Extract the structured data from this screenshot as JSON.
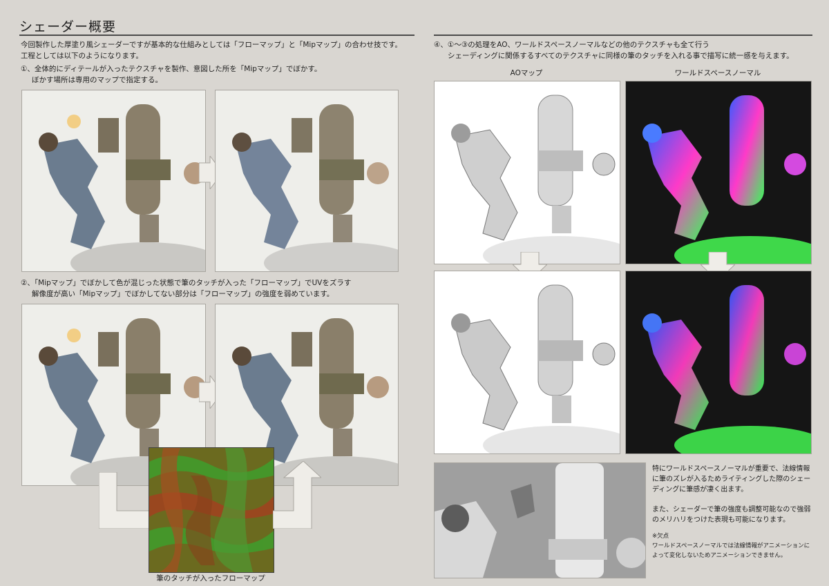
{
  "title": "シェーダー概要",
  "intro": {
    "line1": "今回製作した厚塗り風シェーダーですが基本的な仕組みとしては「フローマップ」と「Mipマップ」の合わせ技です。",
    "line2": "工程としては以下のようになります。"
  },
  "step1": {
    "line1": "①、全体的にディテールが入ったテクスチャを製作、意図した所を「Mipマップ」でぼかす。",
    "line2": "ぼかす場所は専用のマップで指定する。"
  },
  "step2": {
    "line1": "②、「Mipマップ」でぼかして色が混じった状態で筆のタッチが入った「フローマップ」でUVをズラす",
    "line2": "解像度が高い「Mipマップ」でぼかしてない部分は「フローマップ」の強度を弱めています。"
  },
  "flowmap_caption": "筆のタッチが入ったフローマップ",
  "step4": {
    "line1": "④、①～③の処理をAO、ワールドスペースノーマルなどの他のテクスチャも全て行う",
    "line2": "シェーディングに関係するすべてのテクスチャに同様の筆のタッチを入れる事で描写に統一感を与えます。"
  },
  "labels": {
    "ao": "AOマップ",
    "normal": "ワールドスペースノーマル"
  },
  "notes": {
    "p1": [
      "特にワールドスペースノーマルが重要で、法線情報",
      "に筆のズレが入るためライティングした際のシェー",
      "ディングに筆感が凄く出ます。"
    ],
    "p2": [
      "また、シェーダーで筆の強度も調整可能なので強弱",
      "のメリハリをつけた表現も可能になります。"
    ],
    "defect_title": "※欠点",
    "defect": [
      "ワールドスペースノーマルでは法線情報がアニメーションに",
      "よって変化しないためアニメーションできません。"
    ]
  }
}
